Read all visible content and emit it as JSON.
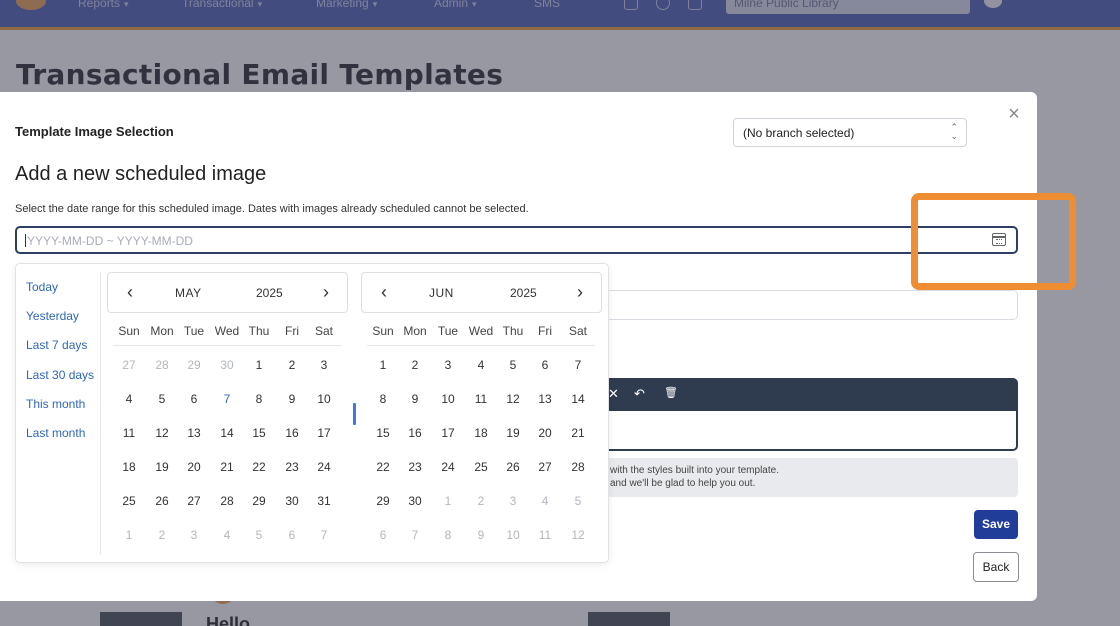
{
  "nav": {
    "items": [
      {
        "label": "Reports",
        "chevron": "▾"
      },
      {
        "label": "Transactional",
        "chevron": "▾"
      },
      {
        "label": "Marketing",
        "chevron": "▾"
      },
      {
        "label": "Admin",
        "chevron": "▾"
      },
      {
        "label": "SMS",
        "chevron": ""
      }
    ],
    "library_search_value": "Milne Public Library",
    "brand_color": "#5a6bb5"
  },
  "page": {
    "title": "Transactional Email Templates",
    "greeting": "Hello"
  },
  "modal": {
    "heading": "Template Image Selection",
    "branch_select_value": "(No branch selected)",
    "section_title": "Add a new scheduled image",
    "help_text": "Select the date range for this scheduled image. Dates with images already scheduled cannot be selected.",
    "range_input_placeholder": "YYYY-MM-DD ~ YYYY-MM-DD",
    "info_line1": "with the styles built into your template.",
    "info_line2": "and we'll be glad to help you out.",
    "save_label": "Save",
    "back_label": "Back",
    "close_glyph": "×",
    "accent_color": "#1f3d99"
  },
  "editor_toolbar": {
    "icons": [
      "clear-format-icon",
      "undo-icon",
      "trash-icon"
    ],
    "glyphs": [
      "✕",
      "↶",
      "🗑"
    ]
  },
  "date_picker": {
    "presets": [
      "Today",
      "Yesterday",
      "Last 7 days",
      "Last 30 days",
      "This month",
      "Last month"
    ],
    "weekdays": [
      "Sun",
      "Mon",
      "Tue",
      "Wed",
      "Thu",
      "Fri",
      "Sat"
    ],
    "prev_glyph": "‹",
    "next_glyph": "›",
    "today_date": "2025-05-07",
    "calendars": [
      {
        "month": "MAY",
        "year": "2025",
        "weeks": [
          [
            {
              "d": "27",
              "m": true
            },
            {
              "d": "28",
              "m": true
            },
            {
              "d": "29",
              "m": true
            },
            {
              "d": "30",
              "m": true
            },
            {
              "d": "1"
            },
            {
              "d": "2"
            },
            {
              "d": "3"
            }
          ],
          [
            {
              "d": "4"
            },
            {
              "d": "5"
            },
            {
              "d": "6"
            },
            {
              "d": "7",
              "t": true
            },
            {
              "d": "8"
            },
            {
              "d": "9"
            },
            {
              "d": "10"
            }
          ],
          [
            {
              "d": "11"
            },
            {
              "d": "12"
            },
            {
              "d": "13"
            },
            {
              "d": "14"
            },
            {
              "d": "15"
            },
            {
              "d": "16"
            },
            {
              "d": "17"
            }
          ],
          [
            {
              "d": "18"
            },
            {
              "d": "19"
            },
            {
              "d": "20"
            },
            {
              "d": "21"
            },
            {
              "d": "22"
            },
            {
              "d": "23"
            },
            {
              "d": "24"
            }
          ],
          [
            {
              "d": "25"
            },
            {
              "d": "26"
            },
            {
              "d": "27"
            },
            {
              "d": "28"
            },
            {
              "d": "29"
            },
            {
              "d": "30"
            },
            {
              "d": "31"
            }
          ],
          [
            {
              "d": "1",
              "m": true
            },
            {
              "d": "2",
              "m": true
            },
            {
              "d": "3",
              "m": true
            },
            {
              "d": "4",
              "m": true
            },
            {
              "d": "5",
              "m": true
            },
            {
              "d": "6",
              "m": true
            },
            {
              "d": "7",
              "m": true
            }
          ]
        ]
      },
      {
        "month": "JUN",
        "year": "2025",
        "weeks": [
          [
            {
              "d": "1"
            },
            {
              "d": "2"
            },
            {
              "d": "3"
            },
            {
              "d": "4"
            },
            {
              "d": "5"
            },
            {
              "d": "6"
            },
            {
              "d": "7"
            }
          ],
          [
            {
              "d": "8"
            },
            {
              "d": "9"
            },
            {
              "d": "10"
            },
            {
              "d": "11"
            },
            {
              "d": "12"
            },
            {
              "d": "13"
            },
            {
              "d": "14"
            }
          ],
          [
            {
              "d": "15"
            },
            {
              "d": "16"
            },
            {
              "d": "17"
            },
            {
              "d": "18"
            },
            {
              "d": "19"
            },
            {
              "d": "20"
            },
            {
              "d": "21"
            }
          ],
          [
            {
              "d": "22"
            },
            {
              "d": "23"
            },
            {
              "d": "24"
            },
            {
              "d": "25"
            },
            {
              "d": "26"
            },
            {
              "d": "27"
            },
            {
              "d": "28"
            }
          ],
          [
            {
              "d": "29"
            },
            {
              "d": "30"
            },
            {
              "d": "1",
              "m": true
            },
            {
              "d": "2",
              "m": true
            },
            {
              "d": "3",
              "m": true
            },
            {
              "d": "4",
              "m": true
            },
            {
              "d": "5",
              "m": true
            }
          ],
          [
            {
              "d": "6",
              "m": true
            },
            {
              "d": "7",
              "m": true
            },
            {
              "d": "8",
              "m": true
            },
            {
              "d": "9",
              "m": true
            },
            {
              "d": "10",
              "m": true
            },
            {
              "d": "11",
              "m": true
            },
            {
              "d": "12",
              "m": true
            }
          ]
        ]
      }
    ]
  },
  "annotation": {
    "highlight_color": "#ef8d33",
    "target": "calendar-icon"
  }
}
